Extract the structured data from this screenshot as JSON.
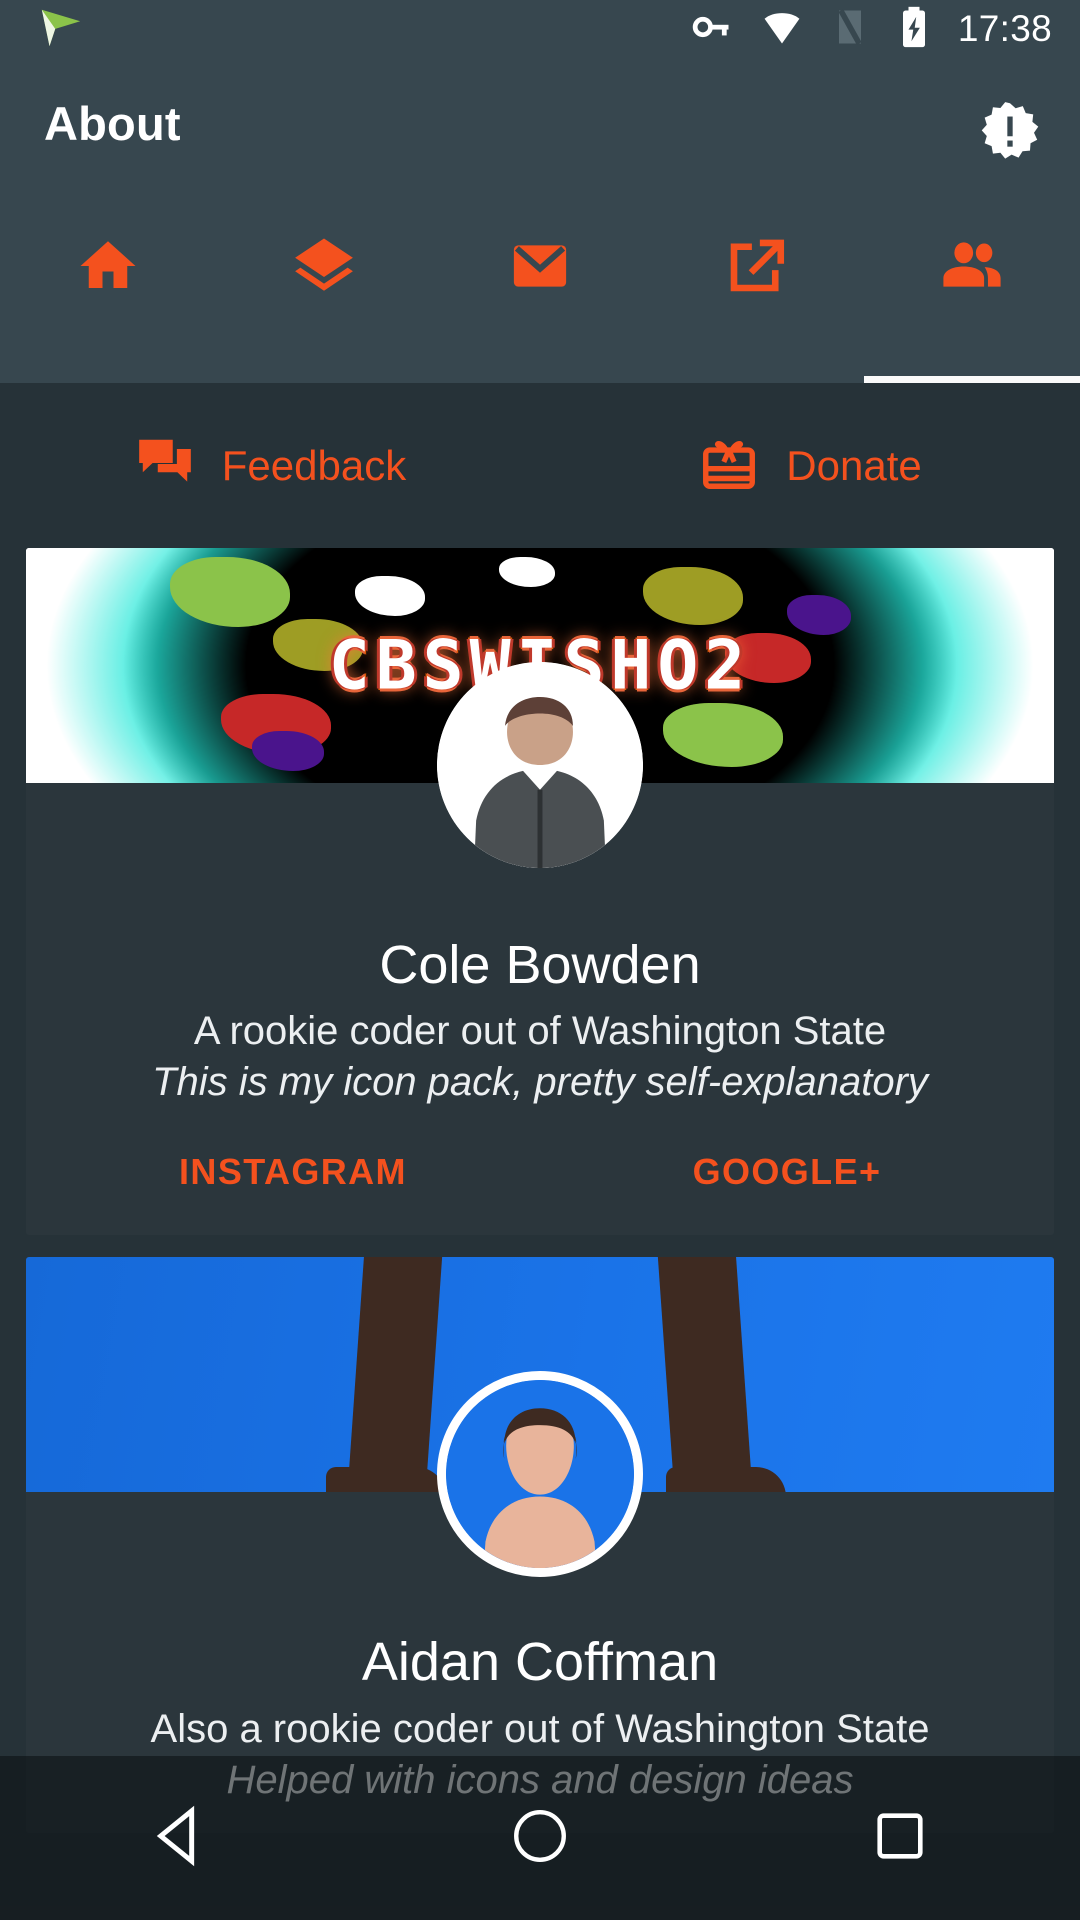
{
  "statusbar": {
    "clock": "17:38",
    "icons": [
      "paper-plane-icon",
      "key-icon",
      "wifi-icon",
      "signal-off-icon",
      "battery-charging-icon"
    ]
  },
  "toolbar": {
    "title": "About",
    "action_icon": "badge-exclamation-icon"
  },
  "tabs": [
    {
      "name": "tab-home",
      "icon": "home-icon",
      "selected": false
    },
    {
      "name": "tab-layers",
      "icon": "layers-icon",
      "selected": false
    },
    {
      "name": "tab-mail",
      "icon": "email-icon",
      "selected": false
    },
    {
      "name": "tab-apply",
      "icon": "open-in-new-icon",
      "selected": false
    },
    {
      "name": "tab-about",
      "icon": "people-icon",
      "selected": true
    }
  ],
  "quick_actions": [
    {
      "label": "Feedback",
      "icon": "forum-icon"
    },
    {
      "label": "Donate",
      "icon": "gift-icon"
    }
  ],
  "cards": [
    {
      "banner_text": "CBSWISHO2",
      "name": "Cole Bowden",
      "line1": "A rookie coder out of Washington State",
      "line2": "This is my icon pack, pretty self-explanatory",
      "actions": [
        "INSTAGRAM",
        "GOOGLE+"
      ]
    },
    {
      "banner_text": "",
      "name": "Aidan Coffman",
      "line1": "Also a rookie coder out of Washington State",
      "line2": "Helped with icons and design ideas",
      "actions": []
    }
  ],
  "navbar": [
    {
      "name": "nav-back",
      "icon": "back-triangle-icon"
    },
    {
      "name": "nav-home",
      "icon": "home-circle-icon"
    },
    {
      "name": "nav-recents",
      "icon": "recents-square-icon"
    }
  ],
  "colors": {
    "accent": "#f4511e",
    "toolbar_bg": "#37474f",
    "content_bg": "#263238",
    "card_bg": "#2b363c",
    "text_primary": "#ffffff"
  }
}
